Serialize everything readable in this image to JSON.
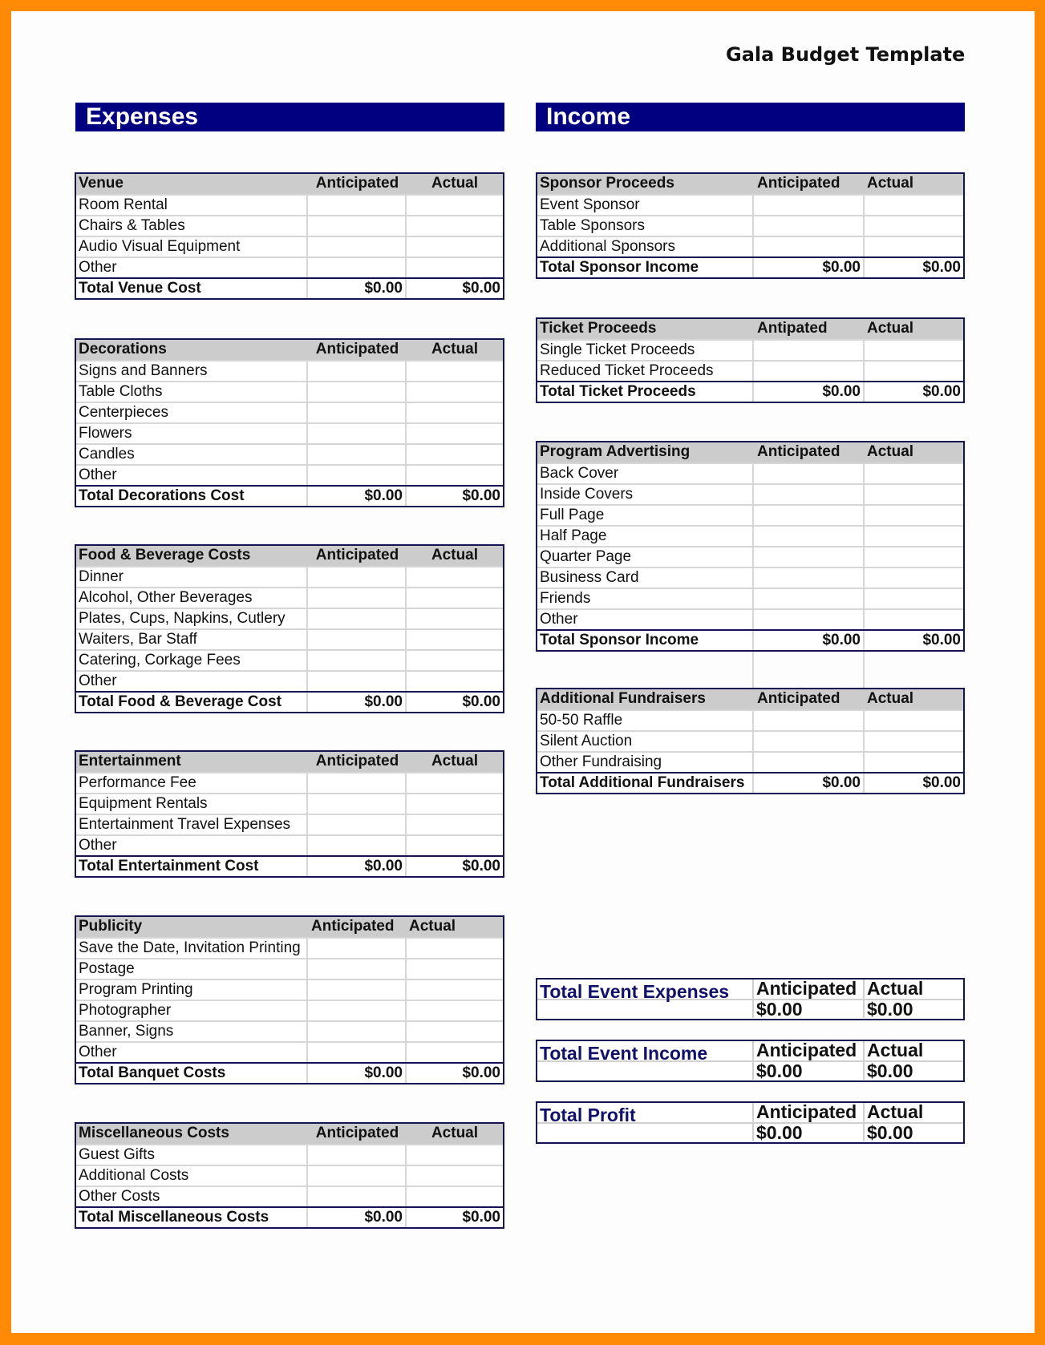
{
  "title": "Gala Budget Template",
  "colors": {
    "border": "#ff8a05",
    "band": "#000080",
    "header_bg": "#cccccc",
    "summary_title": "#10106a"
  },
  "expenses": {
    "heading": "Expenses",
    "tables": [
      {
        "title": "Venue",
        "col_anticipated": "Anticipated",
        "col_actual": "Actual",
        "rows": [
          "Room Rental",
          "Chairs & Tables",
          "Audio Visual Equipment",
          "Other"
        ],
        "total_label": "Total Venue Cost",
        "total_anticipated": "$0.00",
        "total_actual": "$0.00"
      },
      {
        "title": "Decorations",
        "col_anticipated": "Anticipated",
        "col_actual": "Actual",
        "rows": [
          "Signs and Banners",
          "Table Cloths",
          "Centerpieces",
          "Flowers",
          "Candles",
          "Other"
        ],
        "total_label": "Total Decorations Cost",
        "total_anticipated": "$0.00",
        "total_actual": "$0.00"
      },
      {
        "title": "Food & Beverage Costs",
        "col_anticipated": "Anticipated",
        "col_actual": "Actual",
        "rows": [
          "Dinner",
          "Alcohol, Other Beverages",
          "Plates, Cups, Napkins, Cutlery",
          "Waiters, Bar Staff",
          "Catering, Corkage Fees",
          "Other"
        ],
        "total_label": "Total Food & Beverage Cost",
        "total_anticipated": "$0.00",
        "total_actual": "$0.00"
      },
      {
        "title": "Entertainment",
        "col_anticipated": "Anticipated",
        "col_actual": "Actual",
        "rows": [
          "Performance Fee",
          "Equipment Rentals",
          "Entertainment Travel Expenses",
          "Other"
        ],
        "total_label": "Total Entertainment Cost",
        "total_anticipated": "$0.00",
        "total_actual": "$0.00"
      },
      {
        "title": "Publicity",
        "col_anticipated": "Anticipated",
        "col_actual": "Actual",
        "rows": [
          "Save the Date, Invitation Printing",
          "Postage",
          "Program Printing",
          "Photographer",
          "Banner, Signs",
          "Other"
        ],
        "total_label": "Total Banquet Costs",
        "total_anticipated": "$0.00",
        "total_actual": "$0.00"
      },
      {
        "title": "Miscellaneous Costs",
        "col_anticipated": "Anticipated",
        "col_actual": "Actual",
        "rows": [
          "Guest Gifts",
          "Additional Costs",
          "Other Costs"
        ],
        "total_label": "Total Miscellaneous Costs",
        "total_anticipated": "$0.00",
        "total_actual": "$0.00"
      }
    ]
  },
  "income": {
    "heading": "Income",
    "tables": [
      {
        "title": "Sponsor Proceeds",
        "col_anticipated": "Anticipated",
        "col_actual": "Actual",
        "rows": [
          "Event Sponsor",
          "Table Sponsors",
          "Additional Sponsors"
        ],
        "total_label": "Total Sponsor Income",
        "total_anticipated": "$0.00",
        "total_actual": "$0.00"
      },
      {
        "title": "Ticket Proceeds",
        "col_anticipated": "Antipated",
        "col_actual": "Actual",
        "rows": [
          "Single Ticket Proceeds",
          "Reduced Ticket Proceeds"
        ],
        "total_label": "Total Ticket Proceeds",
        "total_anticipated": "$0.00",
        "total_actual": "$0.00"
      },
      {
        "title": "Program Advertising",
        "col_anticipated": "Anticipated",
        "col_actual": "Actual",
        "rows": [
          "Back Cover",
          "Inside Covers",
          "Full Page",
          "Half Page",
          "Quarter Page",
          "Business Card",
          "Friends",
          "Other"
        ],
        "total_label": "Total Sponsor Income",
        "total_anticipated": "$0.00",
        "total_actual": "$0.00"
      },
      {
        "title": "Additional Fundraisers",
        "col_anticipated": "Anticipated",
        "col_actual": "Actual",
        "rows": [
          "50-50 Raffle",
          "Silent Auction",
          "Other Fundraising"
        ],
        "total_label": "Total Additional Fundraisers",
        "total_anticipated": "$0.00",
        "total_actual": "$0.00"
      }
    ]
  },
  "summary": [
    {
      "title": "Total Event Expenses",
      "col_anticipated": "Anticipated",
      "col_actual": "Actual",
      "anticipated": "$0.00",
      "actual": "$0.00"
    },
    {
      "title": "Total Event Income",
      "col_anticipated": "Anticipated",
      "col_actual": "Actual",
      "anticipated": "$0.00",
      "actual": "$0.00"
    },
    {
      "title": "Total Profit",
      "col_anticipated": "Anticipated",
      "col_actual": "Actual",
      "anticipated": "$0.00",
      "actual": "$0.00"
    }
  ]
}
